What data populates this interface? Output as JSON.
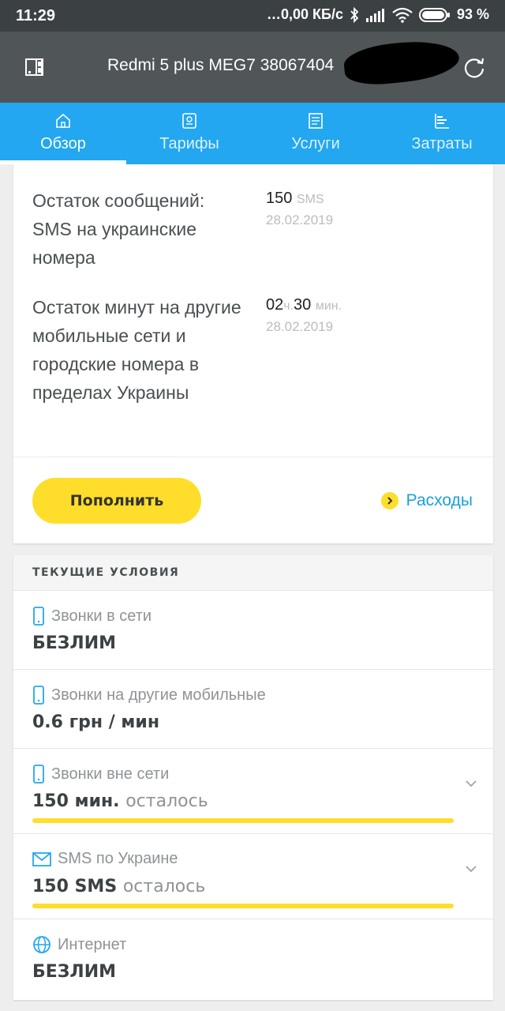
{
  "status_bar": {
    "time": "11:29",
    "network_speed": "…0,00 КБ/с",
    "battery": "93 %"
  },
  "header": {
    "title": "Redmi 5 plus MEG7 38067404"
  },
  "tabs": [
    {
      "label": "Обзор",
      "icon": "home-icon",
      "active": true
    },
    {
      "label": "Тарифы",
      "icon": "tariff-icon",
      "active": false
    },
    {
      "label": "Услуги",
      "icon": "services-icon",
      "active": false
    },
    {
      "label": "Затраты",
      "icon": "expenses-icon",
      "active": false
    }
  ],
  "balances": [
    {
      "label": "Остаток сообщений: SMS на украинские номера",
      "amount": "150",
      "unit": "SMS",
      "date": "28.02.2019"
    },
    {
      "label": "Остаток минут на другие мобильные сети и городские номера в пределах Украины",
      "hours": "02",
      "hours_unit": "ч.",
      "minutes": "30",
      "minutes_unit": "мин.",
      "date": "28.02.2019"
    }
  ],
  "actions": {
    "topup_label": "Пополнить",
    "expenses_label": "Расходы"
  },
  "conditions": {
    "header": "ТЕКУЩИЕ УСЛОВИЯ",
    "items": [
      {
        "title": "Звонки в сети",
        "value": "БЕЗЛИМ",
        "icon": "phone-icon"
      },
      {
        "title": "Звонки на другие мобильные",
        "value": "0.6 грн / мин",
        "icon": "phone-icon"
      },
      {
        "title": "Звонки вне сети",
        "value": "150 мин.",
        "suffix": "осталось",
        "icon": "phone-icon",
        "remaining_fraction": 1.0
      },
      {
        "title": "SMS по Украине",
        "value": "150 SMS",
        "suffix": "осталось",
        "icon": "envelope-icon",
        "remaining_fraction": 1.0
      },
      {
        "title": "Интернет",
        "value": "БЕЗЛИМ",
        "icon": "globe-icon"
      }
    ]
  },
  "colors": {
    "tab_bar": "#22a7f0",
    "accent_yellow": "#fede2a",
    "link_blue": "#1b9ee0",
    "header_bg": "#505558"
  }
}
